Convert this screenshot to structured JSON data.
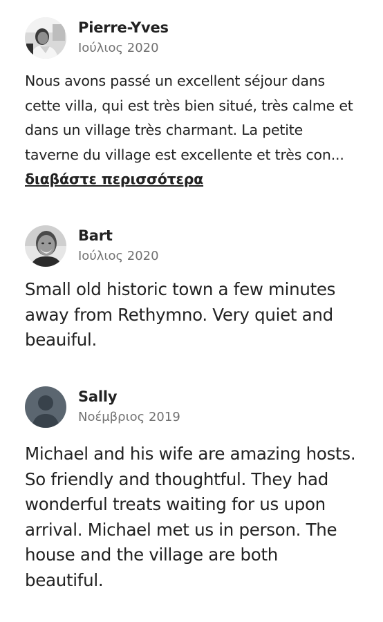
{
  "reviews": [
    {
      "author": "Pierre-Yves",
      "date": "Ιούλιος 2020",
      "text": "Nous avons passé un excellent séjour dans cette villa, qui est très bien situé, très calme et dans un village très charmant. La petite taverne du village est excellente et très con...",
      "read_more": "διαβάστε περισσότερα",
      "avatar_icon": "user-photo-icon"
    },
    {
      "author": "Bart",
      "date": "Ιούλιος 2020",
      "text": "Small old historic town a few minutes away from Rethymno. Very quiet and beauiful.",
      "avatar_icon": "user-photo-icon"
    },
    {
      "author": "Sally",
      "date": "Νοέμβριος 2019",
      "text": "Michael and his wife are amazing hosts. So friendly and thoughtful. They had wonderful treats waiting for us upon arrival. Michael met us in person. The house and the village are both beautiful.",
      "avatar_icon": "default-user-icon"
    }
  ],
  "colors": {
    "text": "#222222",
    "secondary": "#717171",
    "placeholder_avatar": "#5b6670"
  }
}
